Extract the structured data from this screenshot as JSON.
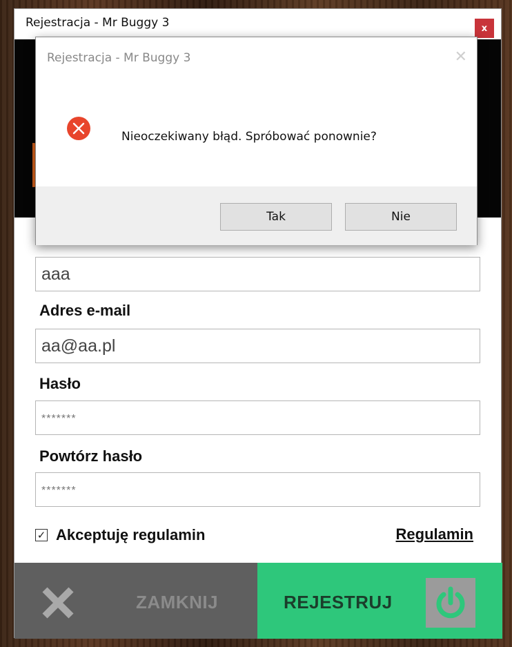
{
  "window": {
    "title": "Rejestracja - Mr Buggy 3",
    "close_glyph": "x"
  },
  "form": {
    "login_value": "aaa",
    "email_label": "Adres e-mail",
    "email_value": "aa@aa.pl",
    "password_label": "Hasło",
    "password_value": "*******",
    "repeat_password_label": "Powtórz hasło",
    "repeat_password_value": "*******",
    "accept_checked": true,
    "accept_label": "Akceptuję regulamin",
    "terms_link": "Regulamin"
  },
  "actions": {
    "close_label": "ZAMKNIJ",
    "register_label": "REJESTRUJ",
    "close_icon": "x-icon",
    "register_icon": "power-icon"
  },
  "dialog": {
    "title": "Rejestracja - Mr Buggy 3",
    "message": "Nieoczekiwany błąd. Spróbować ponownie?",
    "icon": "error-icon",
    "yes_label": "Tak",
    "no_label": "Nie"
  },
  "colors": {
    "register_green": "#2ec77b",
    "close_gray": "#5f5f5f",
    "error_red": "#e8452c",
    "titlebar_close_red": "#c8343a"
  }
}
